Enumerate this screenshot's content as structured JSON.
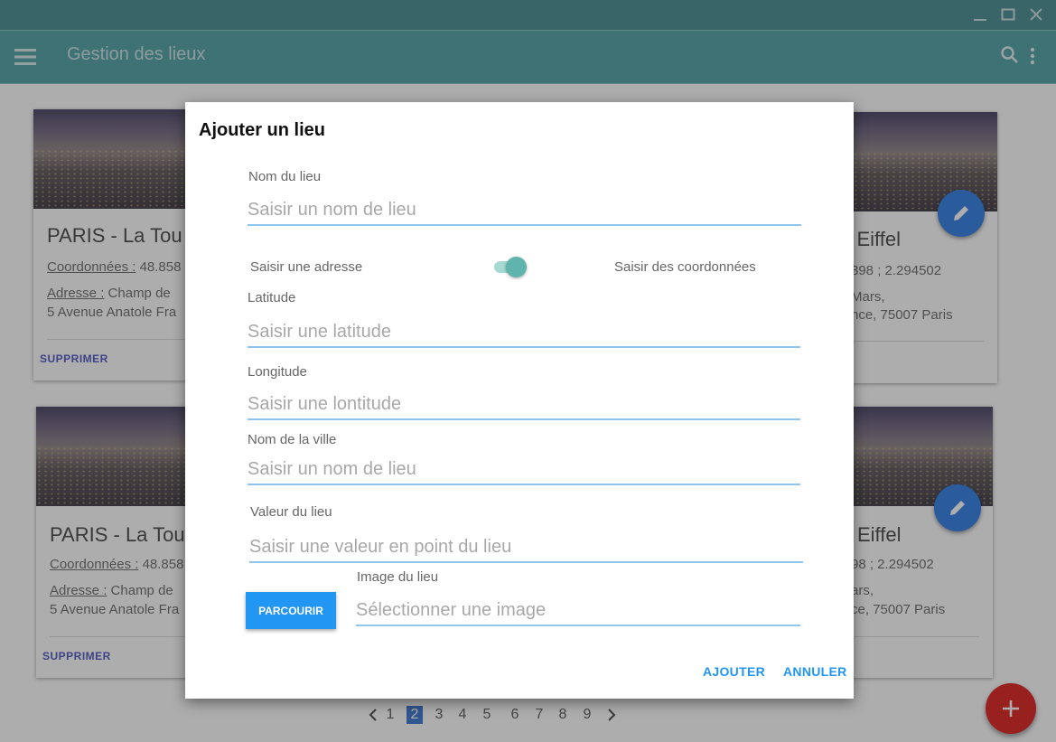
{
  "window": {
    "controls": {
      "minimize_icon": "minimize-icon",
      "maximize_icon": "maximize-icon",
      "close_icon": "close-icon"
    }
  },
  "appbar": {
    "title": "Gestion des lieux",
    "menu_icon": "hamburger-menu-icon",
    "search_icon": "search-icon",
    "more_icon": "more-vertical-icon",
    "color": "#5da8ad"
  },
  "cards": [
    {
      "title": "PARIS - La Tou",
      "coords_label": "Coordonnées :",
      "coords_value": "48.858",
      "address_label": "Adresse :",
      "address_line1": "Champ de",
      "address_line2": "5 Avenue Anatole Fra",
      "delete_label": "SUPPRIMER"
    },
    {
      "title": "r Eiffel",
      "coords_value": "398 ; 2.294502",
      "address_line1": "Mars,",
      "address_line2": "nce, 75007 Paris"
    },
    {
      "title": "PARIS - La Tou",
      "coords_label": "Coordonnées :",
      "coords_value": "48.858",
      "address_label": "Adresse :",
      "address_line1": "Champ de",
      "address_line2": "5 Avenue Anatole Fra",
      "delete_label": "SUPPRIMER"
    },
    {
      "title": "Eiffel",
      "coords_value": "98 ; 2.294502",
      "address_line1": "ars,",
      "address_line2": "ce, 75007 Paris"
    }
  ],
  "pagination": {
    "pages": [
      "1",
      "2",
      "3",
      "4",
      "5",
      "6",
      "7",
      "8",
      "9"
    ],
    "current": "2"
  },
  "dialog": {
    "title": "Ajouter un lieu",
    "name_label": "Nom du lieu",
    "name_placeholder": "Saisir un nom de lieu",
    "toggle_left": "Saisir une adresse",
    "toggle_right": "Saisir des coordonnées",
    "latitude_label": "Latitude",
    "latitude_placeholder": "Saisir une latitude",
    "longitude_label": "Longitude",
    "longitude_placeholder": "Saisir une lontitude",
    "city_label": "Nom de la ville",
    "city_placeholder": "Saisir un nom de lieu",
    "value_label": "Valeur du lieu",
    "value_placeholder": "Saisir une valeur en point du lieu",
    "image_label": "Image du lieu",
    "image_placeholder": "Sélectionner une image",
    "browse_label": "PARCOURIR",
    "add_label": "AJOUTER",
    "cancel_label": "ANNULER"
  },
  "colors": {
    "primary": "#2196f3",
    "fab_add": "#e0302e",
    "fab_edit": "#3f87e8",
    "toggle": "#5fb5ad"
  }
}
